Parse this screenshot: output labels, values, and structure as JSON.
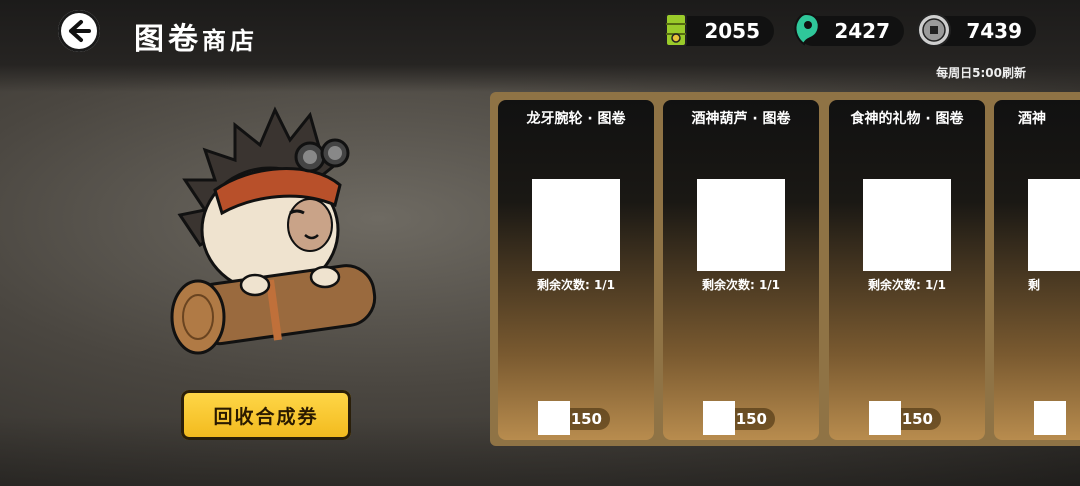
{
  "header": {
    "title_main": "图卷",
    "title_sub": "商店"
  },
  "currencies": [
    {
      "icon": "bamboo-scroll-icon",
      "value": "2055"
    },
    {
      "icon": "green-magatama-icon",
      "value": "2427"
    },
    {
      "icon": "coin-icon",
      "value": "7439"
    }
  ],
  "refresh_text": "每周日5:00刷新",
  "redeem_label": "回收合成券",
  "cards": [
    {
      "title": "龙牙腕轮 · 图卷",
      "remain": "剩余次数: 1/1",
      "price": "150"
    },
    {
      "title": "酒神葫芦 · 图卷",
      "remain": "剩余次数: 1/1",
      "price": "150"
    },
    {
      "title": "食神的礼物 · 图卷",
      "remain": "剩余次数: 1/1",
      "price": "150"
    },
    {
      "title": "酒神",
      "remain": "剩",
      "price": ""
    }
  ],
  "colors": {
    "accent_yellow": "#f2b91c",
    "panel": "#8f7345"
  }
}
